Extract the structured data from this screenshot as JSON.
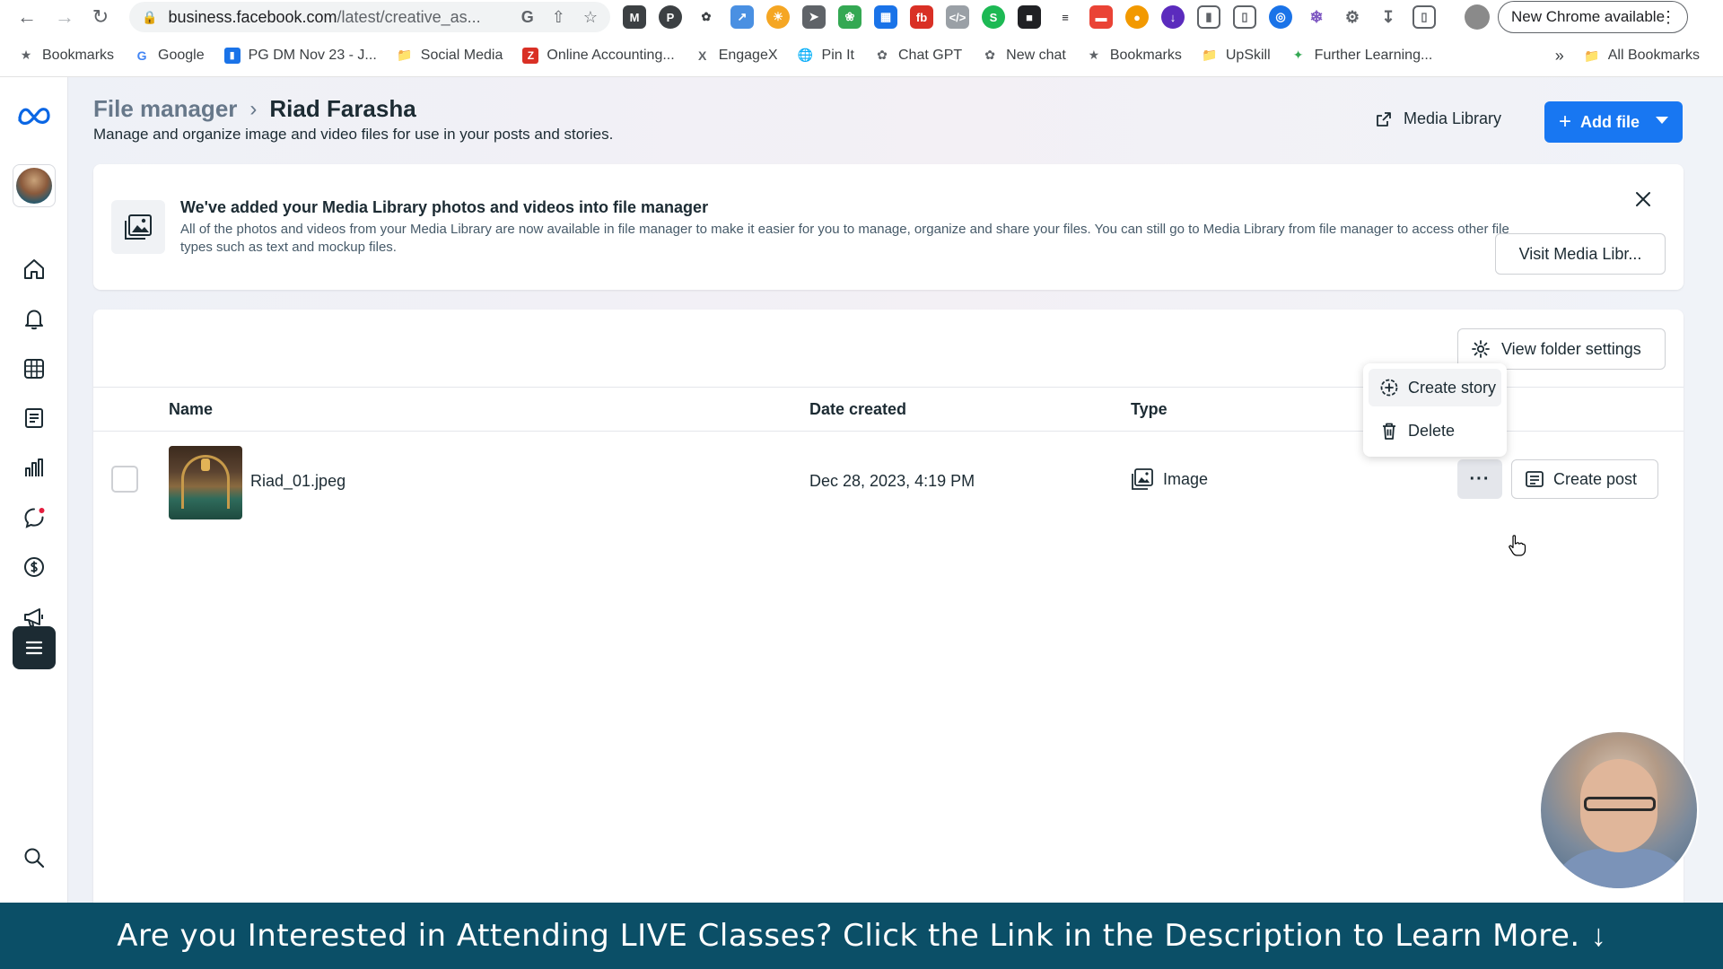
{
  "browser": {
    "url_host": "business.facebook.com",
    "url_path": "/latest/creative_as...",
    "chrome_pill": "New Chrome available",
    "bookmarks": [
      "Bookmarks",
      "Google",
      "PG DM Nov 23 - J...",
      "Social Media",
      "Online Accounting...",
      "EngageX",
      "Pin It",
      "Chat GPT",
      "New chat",
      "Bookmarks",
      "UpSkill",
      "Further Learning..."
    ],
    "overflow": "»",
    "all_bookmarks": "All Bookmarks"
  },
  "header": {
    "breadcrumb_parent": "File manager",
    "breadcrumb_current": "Riad Farasha",
    "subtitle": "Manage and organize image and video files for use in your posts and stories.",
    "media_library": "Media Library",
    "add_file": "Add file"
  },
  "banner": {
    "title": "We've added your Media Library photos and videos into file manager",
    "body": "All of the photos and videos from your Media Library are now available in file manager to make it easier for you to manage, organize and share your files. You can still go to Media Library from file manager to access other file types such as text and mockup files.",
    "visit_button": "Visit Media Libr..."
  },
  "panel": {
    "folder_settings": "View folder settings",
    "columns": [
      "Name",
      "Date created",
      "Type"
    ],
    "rows": [
      {
        "name": "Riad_01.jpeg",
        "date": "Dec 28, 2023, 4:19 PM",
        "type": "Image"
      }
    ],
    "more": "···",
    "create_post": "Create post",
    "menu": [
      "Create story",
      "Delete"
    ]
  },
  "promo": {
    "text": "Are you Interested in Attending LIVE Classes? Click the Link in the Description to Learn More.",
    "arrow": "🠗"
  },
  "colors": {
    "accent": "#1877f2",
    "promo_bg": "#0b4f67",
    "text": "#1c2b33"
  }
}
